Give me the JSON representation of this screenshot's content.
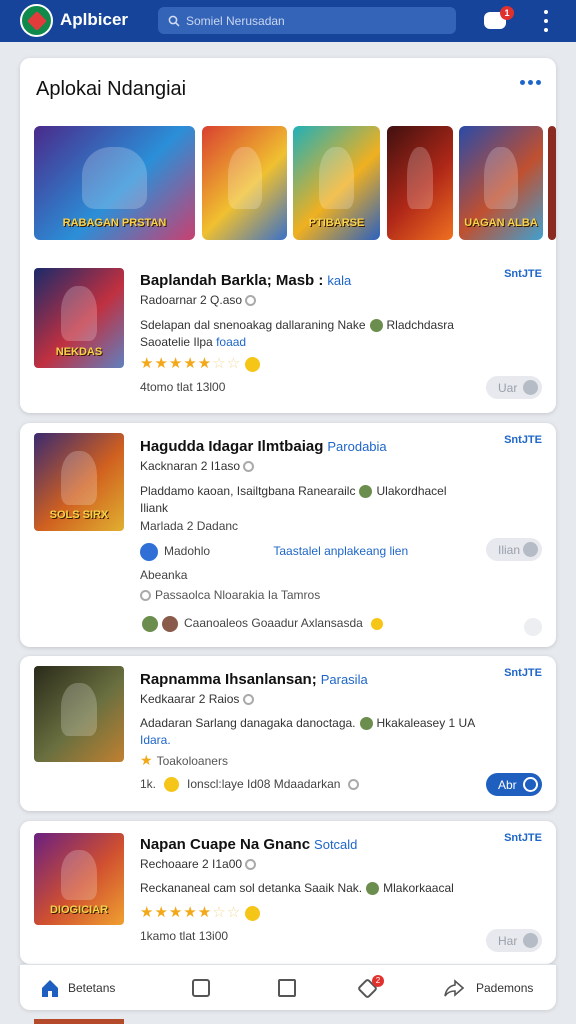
{
  "header": {
    "app_title": "Aplbicer",
    "search_placeholder": "Somiel Nerusadan",
    "notification_count": "1"
  },
  "featured": {
    "title": "Aplokai Ndangiai",
    "tiles": [
      {
        "caption": "RABAGAN PRSTAN",
        "colors": [
          "#4a2a8a",
          "#2b8fd8",
          "#c94070"
        ]
      },
      {
        "caption": "",
        "colors": [
          "#d94030",
          "#f0c030",
          "#3a70c8"
        ]
      },
      {
        "caption": "PTIBARSE",
        "colors": [
          "#20b0b8",
          "#f0b020",
          "#2a60c0"
        ]
      },
      {
        "caption": "",
        "colors": [
          "#401010",
          "#b02818",
          "#f07020"
        ]
      },
      {
        "caption": "UAGAN ALBA",
        "colors": [
          "#2a4aa8",
          "#c05030",
          "#40a0d0"
        ]
      }
    ]
  },
  "apps": [
    {
      "thumb_caption": "NEKDAS",
      "thumb_colors": [
        "#1a2a6a",
        "#c03040",
        "#6080c0"
      ],
      "name": "Baplandah Barkla; Masb :",
      "tag": "kala",
      "size": "SntJTE",
      "publisher": "Radoarnar 2 Q.aso",
      "desc_line1": "Sdelapan dal snenoakag dallaraning Nake",
      "desc_line1_tail": "Rladchdasra",
      "desc_line2": "Saoatelie Ilpa",
      "desc_link": "foaad",
      "stars_full": "★★★★★",
      "stars_dim": "☆☆",
      "meta": "4tomo tlat 13l00",
      "button": "Uar"
    },
    {
      "thumb_caption": "SOLS SIRX",
      "thumb_colors": [
        "#3a2a70",
        "#d06020",
        "#e0b030"
      ],
      "name": "Hagudda Idagar Ilmtbaiag",
      "tag": "Parodabia",
      "size": "SntJTE",
      "publisher": "Kacknaran 2 I1aso",
      "desc_line1": "Pladdamo kaoan, Isailtgbana Ranearailc",
      "desc_line1_tail": "Ulakordhacel",
      "desc_line2": "Iliank",
      "extra_line": "Marlada 2 Dadanc",
      "social_name": "Madohlo",
      "social_link": "Taastalel anplakeang lien",
      "social_sub": "Abeanka",
      "location": "Passaolca Nloarakia Ia Tamros",
      "friends": "Caanoaleos Goaadur Axlansasda",
      "button": "Ilian"
    },
    {
      "thumb_caption": "",
      "thumb_colors": [
        "#2a2a1a",
        "#6a7040",
        "#c08030"
      ],
      "name": "Rapnamma Ihsanlansan;",
      "tag": "Parasila",
      "size": "SntJTE",
      "publisher": "Kedkaarar 2 Raios",
      "desc_line1": "Adadaran Sarlang danagaka danoctaga.",
      "desc_line1_tail": "Hkakaleasey 1 UA",
      "desc_line2": "",
      "desc_link": "Idara.",
      "award": "Toakoloaners",
      "meta": "Ionscl:laye Id08 Mdaadarkan",
      "meta_prefix": "1k.",
      "button": "Abr"
    },
    {
      "thumb_caption": "DIOGICIAR",
      "thumb_colors": [
        "#6a2080",
        "#d05030",
        "#f0a030"
      ],
      "name": "Napan Cuape Na Gnanc",
      "tag": "Sotcald",
      "size": "SntJTE",
      "publisher": "Rechoaare 2 I1a00",
      "desc_line1": "Reckananeal cam sol detanka Saaik Nak.",
      "desc_line1_tail": "Mlakorkaacal",
      "stars_full": "★★★★★",
      "stars_dim": "☆☆",
      "meta": "1kamo tlat 13i00",
      "button": "Har"
    }
  ],
  "bottom_nav": {
    "home_label": "Betetans",
    "badge_count": "2",
    "last_label": "Pademons"
  }
}
